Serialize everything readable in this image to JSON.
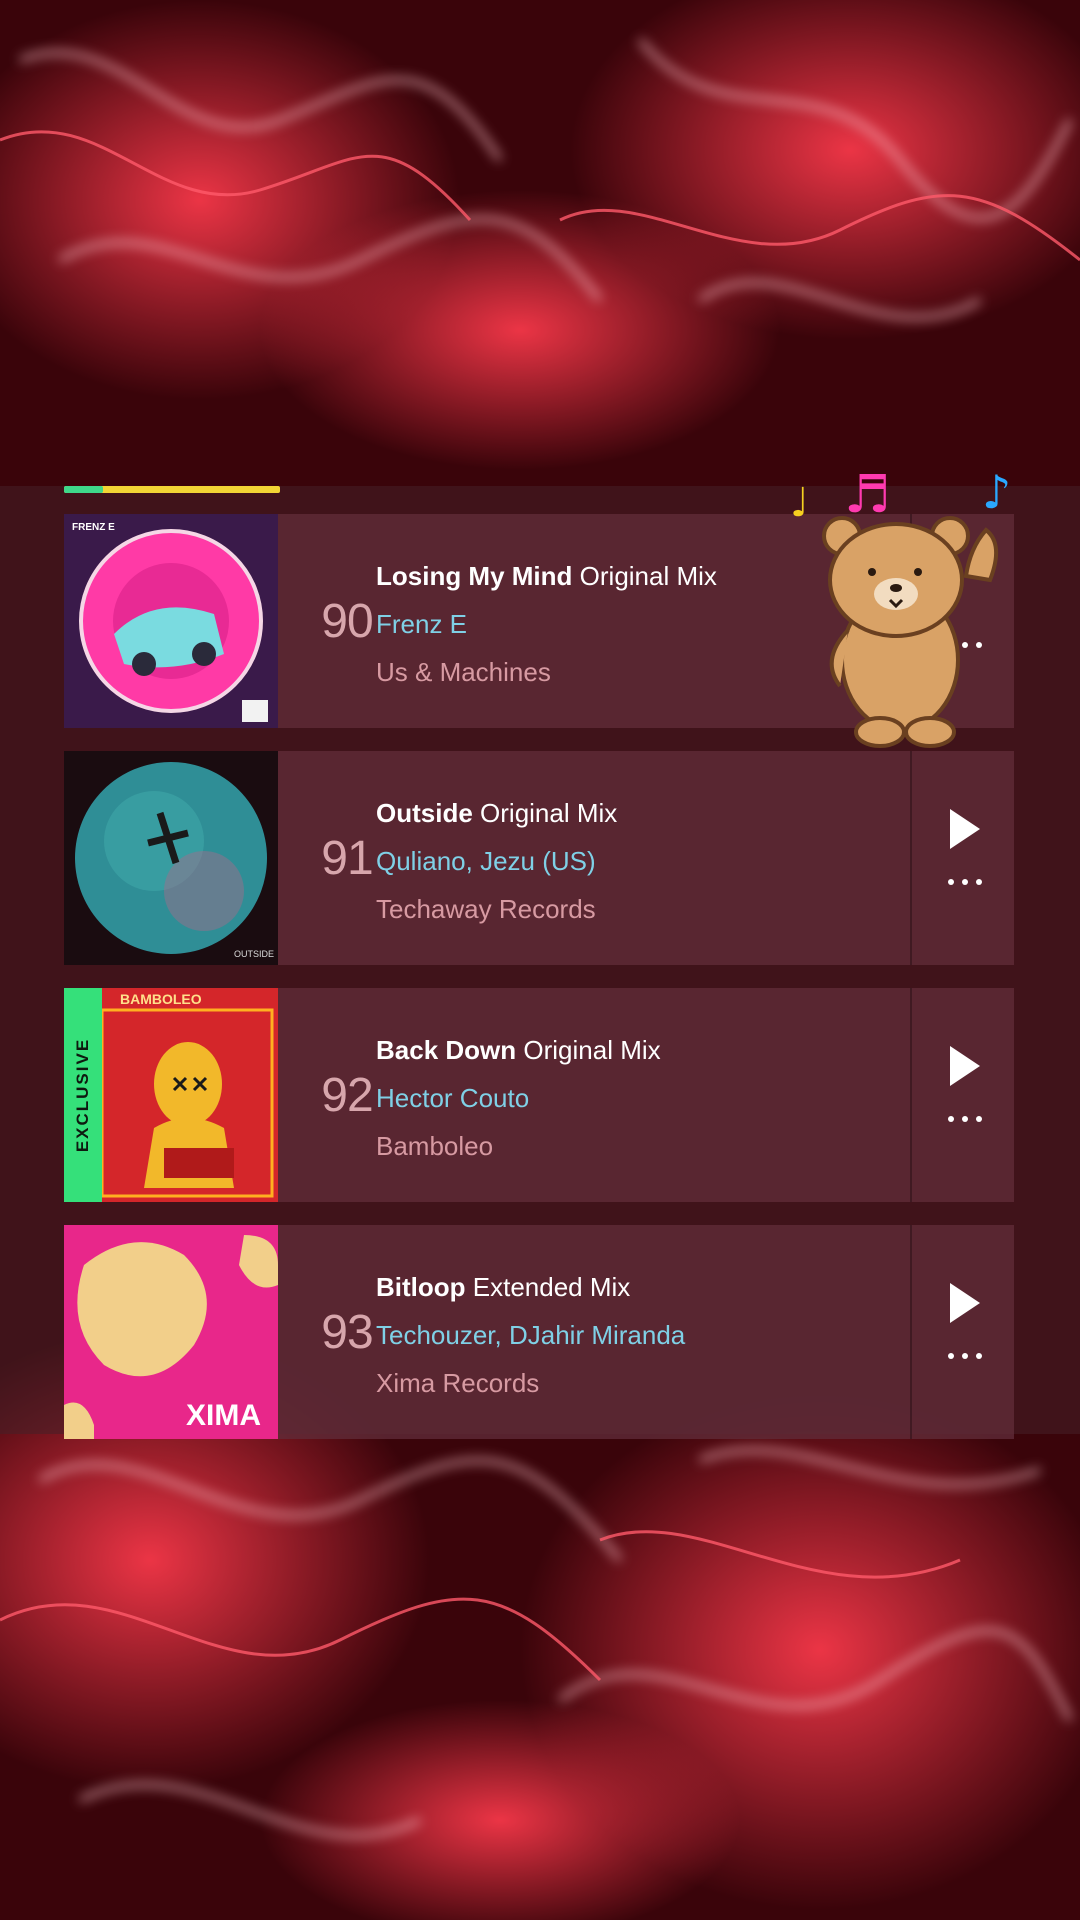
{
  "playlist": {
    "progress_fraction": 0.18,
    "tracks": [
      {
        "position": "90",
        "title": "Losing My Mind",
        "mix": "Original Mix",
        "artists": "Frenz E",
        "label": "Us & Machines",
        "art_text": "FRENZ E",
        "exclusive": false
      },
      {
        "position": "91",
        "title": "Outside",
        "mix": "Original Mix",
        "artists": "Quliano, Jezu (US)",
        "label": "Techaway Records",
        "art_text": "OUTSIDE",
        "exclusive": false
      },
      {
        "position": "92",
        "title": "Back Down",
        "mix": "Original Mix",
        "artists": "Hector Couto",
        "label": "Bamboleo",
        "art_text": "BAMBOLEO",
        "exclusive": true,
        "badge": "EXCLUSIVE"
      },
      {
        "position": "93",
        "title": "Bitloop",
        "mix": "Extended Mix",
        "artists": "Techouzer, DJahir Miranda",
        "label": "Xima Records",
        "art_text": "XIMA",
        "exclusive": false
      }
    ]
  },
  "icons": {
    "play": "play-icon",
    "more": "more-options-icon",
    "sticker": "dancing-bear-sticker"
  },
  "colors": {
    "accent_progress": "#f2d535",
    "exclusive_badge": "#35e07a",
    "artist_text": "#7fd0e6",
    "label_text": "#d79aa2"
  }
}
